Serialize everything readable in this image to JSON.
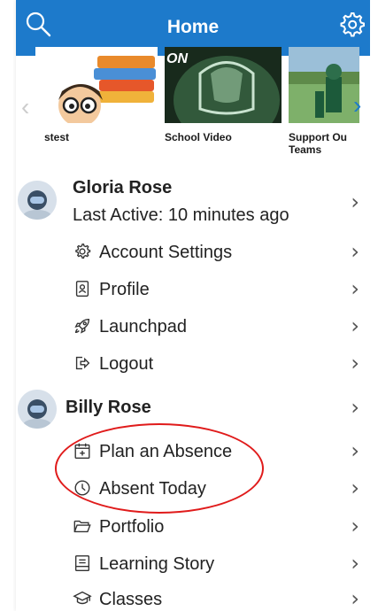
{
  "header": {
    "title": "Home",
    "search_icon": "search-icon",
    "settings_icon": "gear-icon",
    "bg": "#1d7acb"
  },
  "carousel": {
    "cards": [
      {
        "label": "stest"
      },
      {
        "label": "School Video"
      },
      {
        "label_line1": "Support Ou",
        "label_line2": "Teams"
      }
    ]
  },
  "users": [
    {
      "name": "Gloria Rose",
      "status": "Last Active: 10 minutes ago",
      "menu": [
        {
          "label": "Account Settings",
          "icon": "gear-icon"
        },
        {
          "label": "Profile",
          "icon": "profile-icon"
        },
        {
          "label": "Launchpad",
          "icon": "rocket-icon"
        },
        {
          "label": "Logout",
          "icon": "logout-icon"
        }
      ]
    },
    {
      "name": "Billy Rose",
      "menu": [
        {
          "label": "Plan an Absence",
          "icon": "calendar-icon"
        },
        {
          "label": "Absent Today",
          "icon": "clock-icon"
        },
        {
          "label": "Portfolio",
          "icon": "folder-icon"
        },
        {
          "label": "Learning Story",
          "icon": "story-icon"
        },
        {
          "label": "Classes",
          "icon": "graduation-cap-icon"
        }
      ]
    }
  ],
  "annotation_color": "#e01b1b"
}
